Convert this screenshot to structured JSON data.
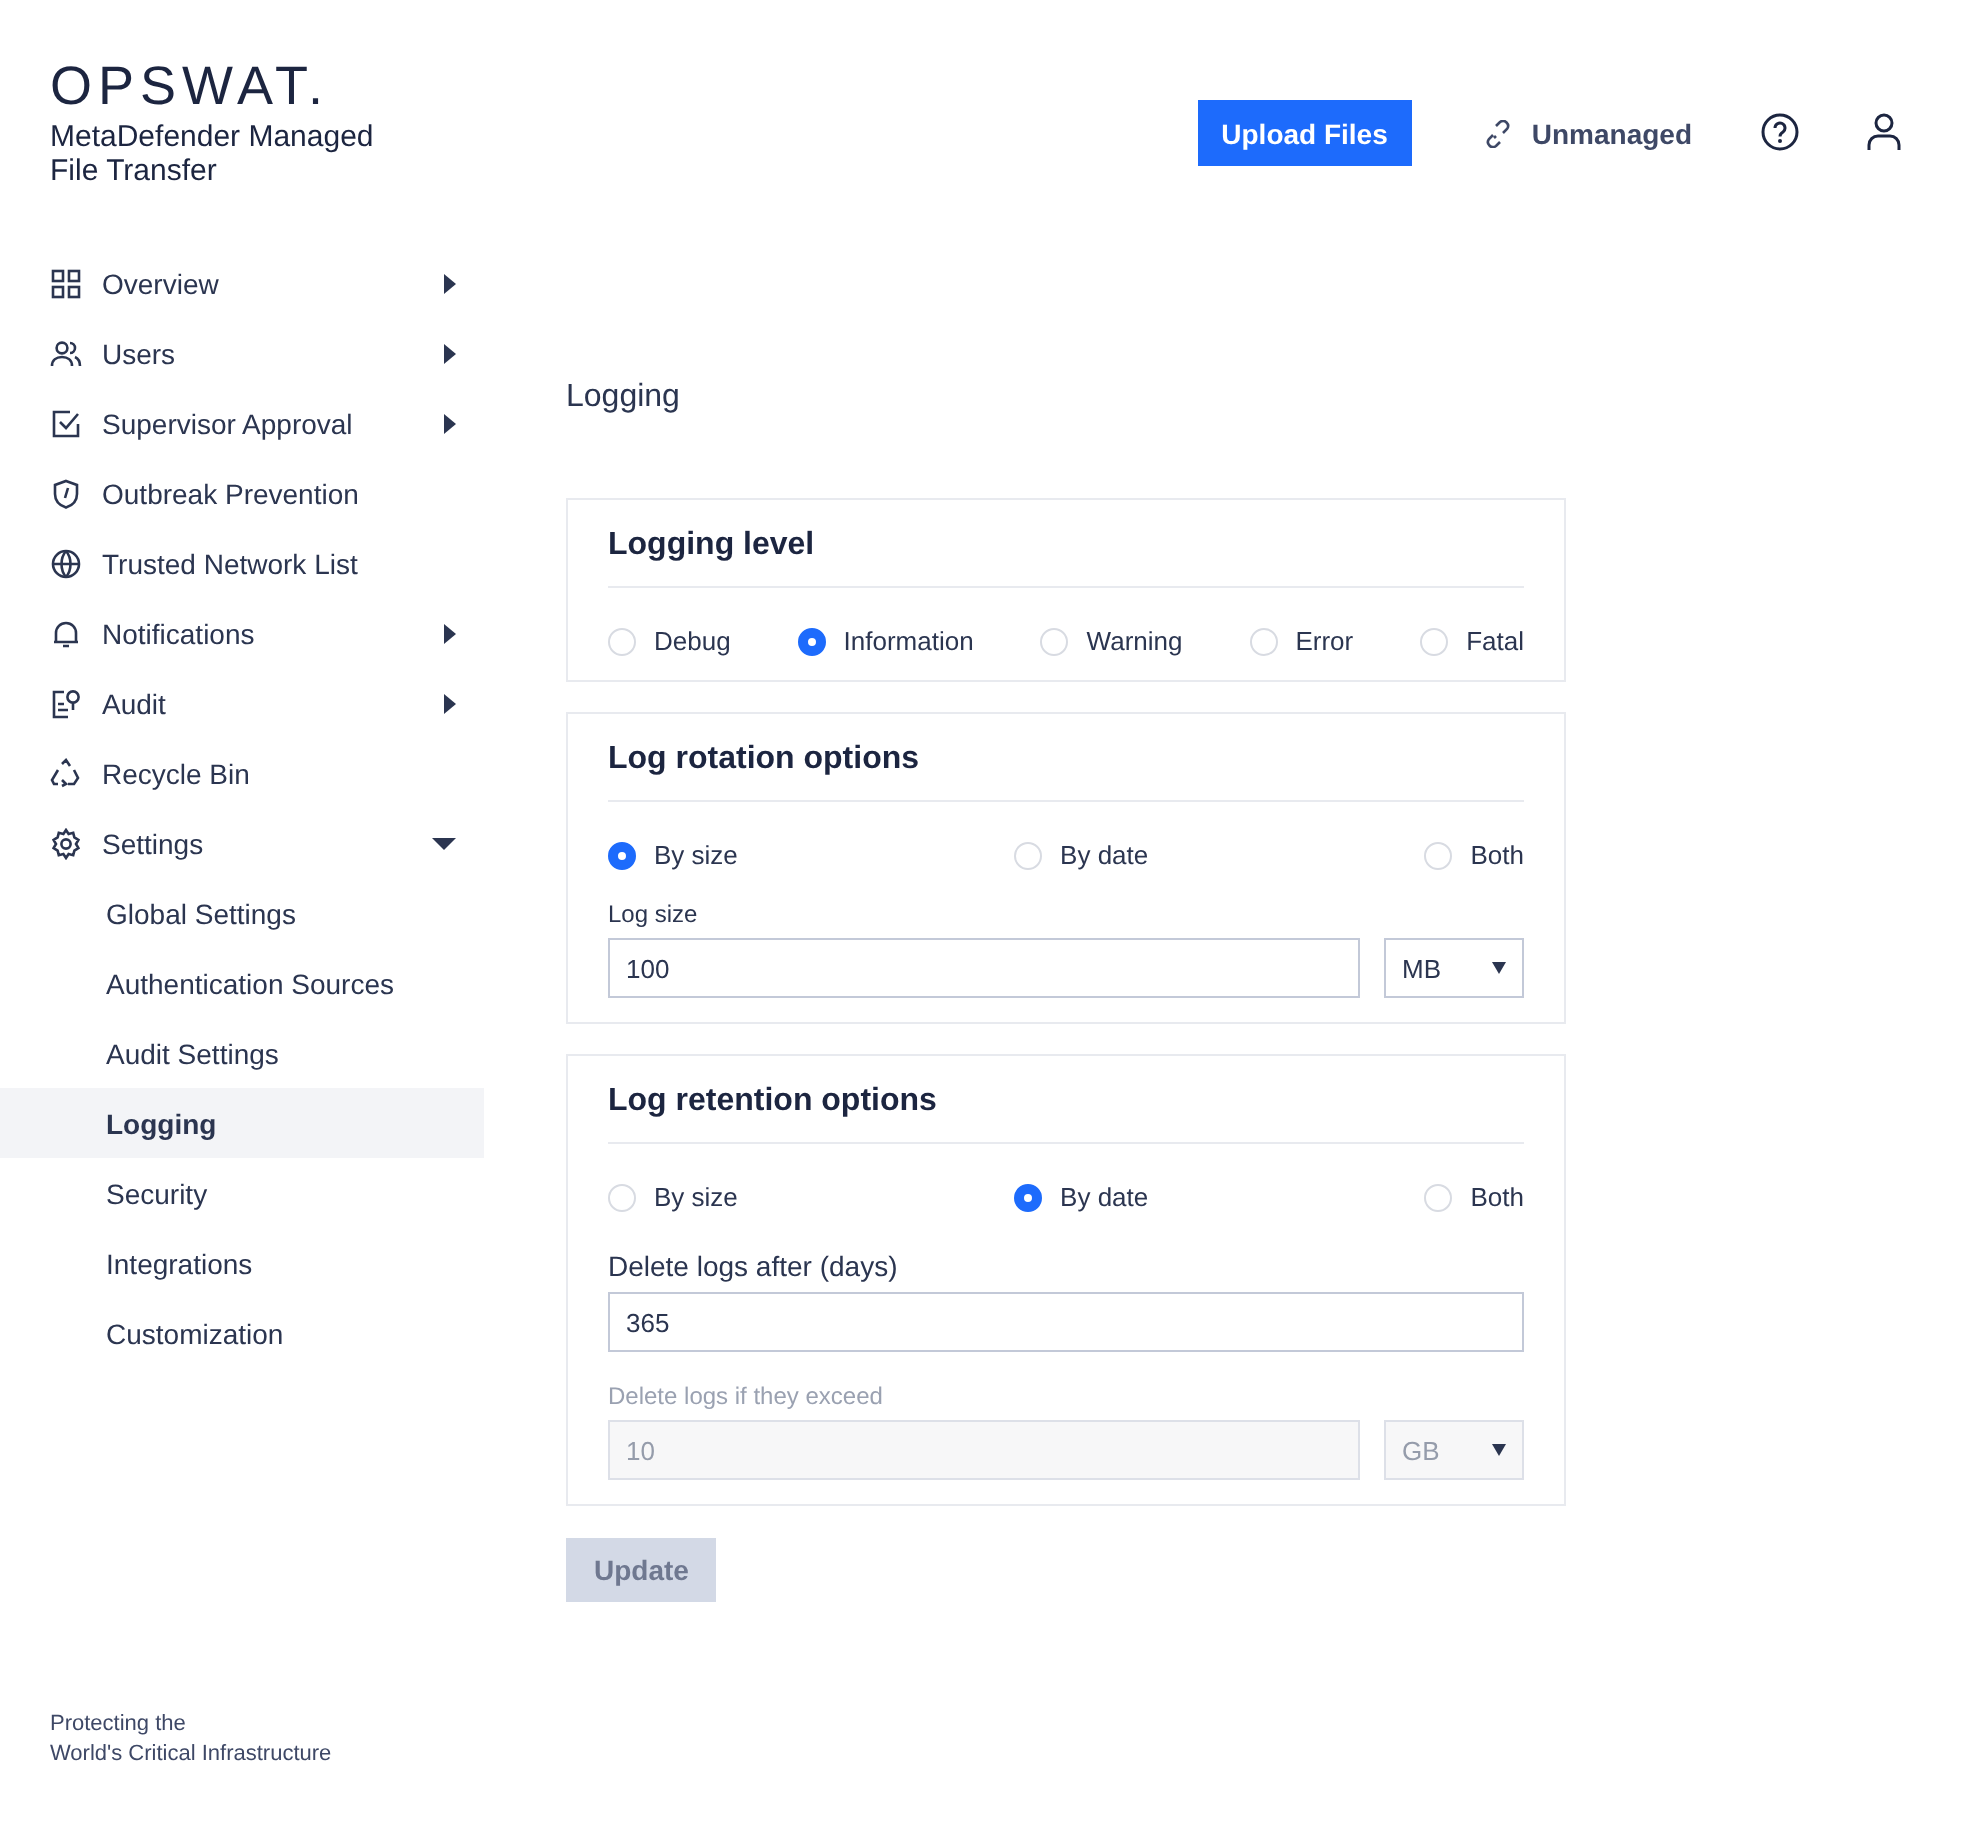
{
  "brand": {
    "logo": "OPSWAT.",
    "product": "MetaDefender Managed File Transfer"
  },
  "header": {
    "upload_button": "Upload Files",
    "mode_link": "Unmanaged"
  },
  "sidebar": {
    "items": [
      {
        "label": "Overview",
        "expanded": false,
        "selected": false
      },
      {
        "label": "Users",
        "expanded": false,
        "selected": false
      },
      {
        "label": "Supervisor Approval",
        "expanded": false,
        "selected": false
      },
      {
        "label": "Outbreak Prevention",
        "selected": false
      },
      {
        "label": "Trusted Network List",
        "selected": false
      },
      {
        "label": "Notifications",
        "expanded": false,
        "selected": false
      },
      {
        "label": "Audit",
        "expanded": false,
        "selected": false
      },
      {
        "label": "Recycle Bin",
        "selected": false
      },
      {
        "label": "Settings",
        "expanded": true,
        "selected": false,
        "children": [
          {
            "label": "Global Settings",
            "selected": false
          },
          {
            "label": "Authentication Sources",
            "selected": false
          },
          {
            "label": "Audit Settings",
            "selected": false
          },
          {
            "label": "Logging",
            "selected": true
          },
          {
            "label": "Security",
            "selected": false
          },
          {
            "label": "Integrations",
            "selected": false
          },
          {
            "label": "Customization",
            "selected": false
          }
        ]
      }
    ]
  },
  "page_title": "Logging",
  "sections": [
    {
      "title": "Logging level",
      "options": [
        {
          "label": "Debug",
          "selected": false
        },
        {
          "label": "Information",
          "selected": true
        },
        {
          "label": "Warning",
          "selected": false
        },
        {
          "label": "Error",
          "selected": false
        },
        {
          "label": "Fatal",
          "selected": false
        }
      ]
    },
    {
      "title": "Log rotation options",
      "options": [
        {
          "label": "By size",
          "selected": true
        },
        {
          "label": "By date",
          "selected": false
        },
        {
          "label": "Both",
          "selected": false
        }
      ],
      "fields": [
        {
          "label": "Log size",
          "value": "100",
          "unit": "MB",
          "disabled": false
        }
      ]
    },
    {
      "title": "Log retention options",
      "options": [
        {
          "label": "By size",
          "selected": false
        },
        {
          "label": "By date",
          "selected": true
        },
        {
          "label": "Both",
          "selected": false
        }
      ],
      "fields": [
        {
          "label": "Delete logs after (days)",
          "value": "365",
          "disabled": false
        },
        {
          "label": "Delete logs if they exceed",
          "value": "10",
          "unit": "GB",
          "disabled": true
        }
      ]
    }
  ],
  "update_button": {
    "label": "Update",
    "disabled": true
  },
  "footer": [
    "Protecting the",
    "World's Critical Infrastructure"
  ]
}
